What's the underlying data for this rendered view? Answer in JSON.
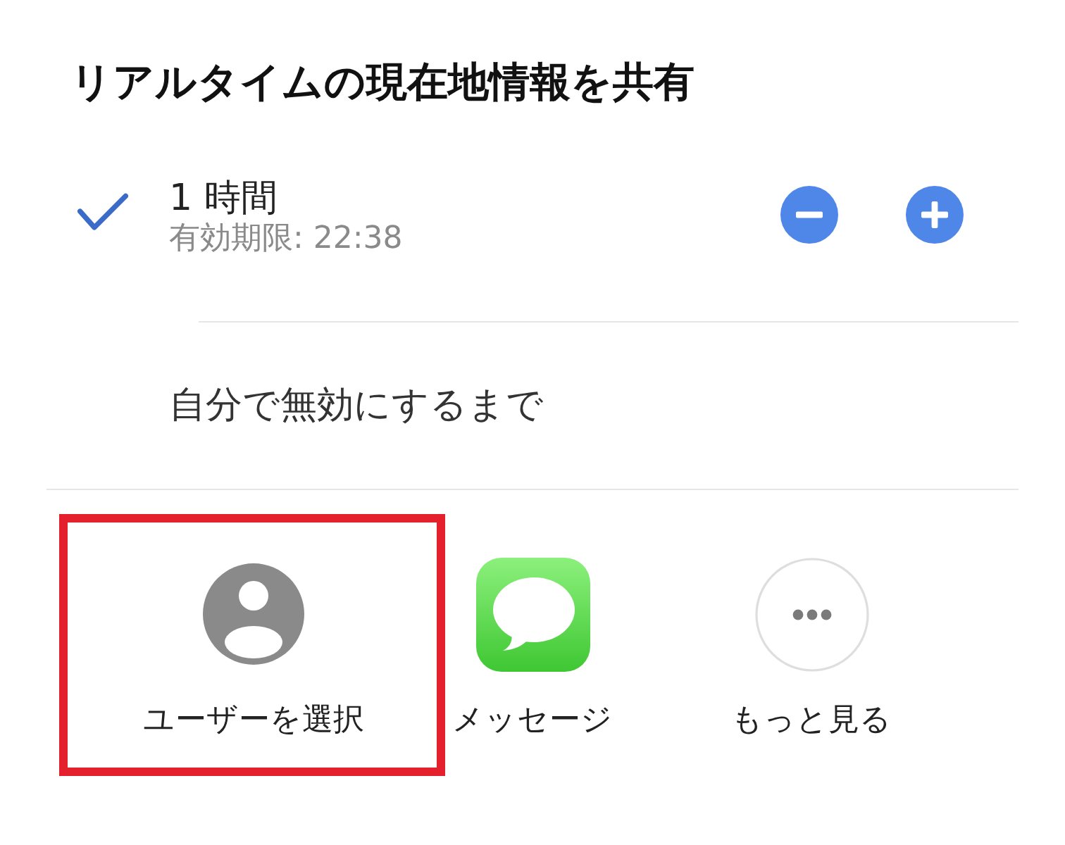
{
  "title": "リアルタイムの現在地情報を共有",
  "options": [
    {
      "kind": "timed",
      "label": "1 時間",
      "expiry": "有効期限: 22:38",
      "selected": true
    },
    {
      "kind": "plain",
      "label": "自分で無効にするまで",
      "selected": false
    }
  ],
  "share_targets": [
    {
      "kind": "contact",
      "label": "ユーザーを選択",
      "highlighted": true
    },
    {
      "kind": "messages",
      "label": "メッセージ",
      "highlighted": false
    },
    {
      "kind": "more",
      "label": "もっと見る",
      "highlighted": false
    }
  ]
}
